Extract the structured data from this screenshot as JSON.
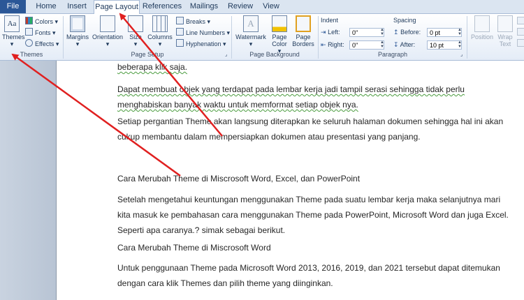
{
  "tabs": [
    {
      "label": "File"
    },
    {
      "label": "Home"
    },
    {
      "label": "Insert"
    },
    {
      "label": "Page Layout"
    },
    {
      "label": "References"
    },
    {
      "label": "Mailings"
    },
    {
      "label": "Review"
    },
    {
      "label": "View"
    }
  ],
  "ribbon": {
    "themes": {
      "big": "Themes",
      "colors": "Colors",
      "fonts": "Fonts",
      "effects": "Effects",
      "group": "Themes"
    },
    "page_setup": {
      "margins": "Margins",
      "orientation": "Orientation",
      "size": "Size",
      "columns": "Columns",
      "breaks": "Breaks",
      "line_numbers": "Line Numbers",
      "hyphenation": "Hyphenation",
      "group": "Page Setup"
    },
    "page_background": {
      "watermark": "Watermark",
      "page_color": "Page Color",
      "page_borders": "Page Borders",
      "group": "Page Background"
    },
    "paragraph": {
      "indent": "Indent",
      "left_label": "Left:",
      "left_value": "0\"",
      "right_label": "Right:",
      "right_value": "0\"",
      "spacing": "Spacing",
      "before_label": "Before:",
      "before_value": "0 pt",
      "after_label": "After:",
      "after_value": "10 pt",
      "group": "Paragraph"
    },
    "arrange": {
      "position": "Position",
      "wrap_text": "Wrap Text"
    }
  },
  "document": {
    "p0": "beberapa klik saja.",
    "p1_a": "Dapat membuat objek yang terdapat pada lembar kerja jadi tampil serasi sehingga tidak perlu",
    "p1_b": "menghabiskan banyak waktu untuk memformat setiap objek nya.",
    "p2_a": "Setiap pergantian Theme akan langsung diterapkan ke seluruh halaman dokumen sehingga hal ini akan",
    "p2_b": "cukup membantu dalam mempersiapkan dokumen atau presentasi yang panjang.",
    "h1": "Cara Merubah Theme di Miscrosoft Word, Excel, dan PowerPoint",
    "p3_a": "Setelah mengetahui keuntungan menggunakan Theme pada suatu lembar kerja maka selanjutnya mari",
    "p3_b": "kita masuk ke pembahasan cara menggunakan Theme pada PowerPoint, Microsoft Word dan juga Excel.",
    "p3_c": "Seperti apa caranya.? simak sebagai berikut.",
    "h2": "Cara Merubah Theme di Miscrosoft Word",
    "p4_a": "Untuk penggunaan Theme pada Microsoft Word 2013, 2016, 2019, dan 2021 tersebut dapat ditemukan",
    "p4_b": "dengan cara klik Themes dan pilih theme yang diinginkan."
  },
  "colors": {
    "file_tab": "#2b5797",
    "arrow": "#e02020",
    "squiggle": "#4a9c3e"
  }
}
